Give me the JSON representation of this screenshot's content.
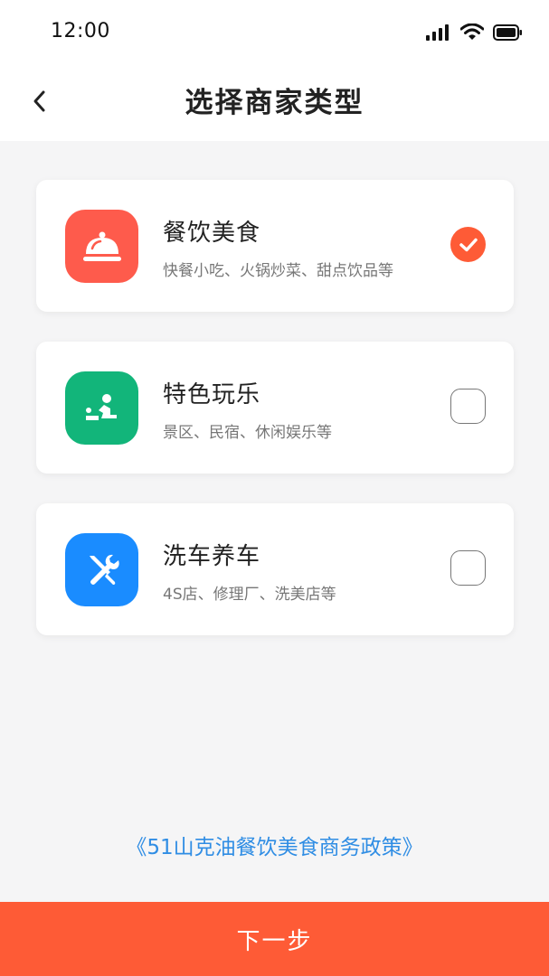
{
  "status_bar": {
    "time": "12:00",
    "icons": [
      "signal-icon",
      "wifi-icon",
      "battery-icon"
    ]
  },
  "header": {
    "back_icon": "chevron-left-icon",
    "title": "选择商家类型"
  },
  "options": [
    {
      "title": "餐饮美食",
      "subtitle": "快餐小吃、火锅炒菜、甜点饮品等",
      "icon": "cloche-icon",
      "icon_color": "#fe5b4c",
      "selected": true
    },
    {
      "title": "特色玩乐",
      "subtitle": "景区、民宿、休闲娱乐等",
      "icon": "recreation-icon",
      "icon_color": "#12b57a",
      "selected": false
    },
    {
      "title": "洗车养车",
      "subtitle": "4S店、修理厂、洗美店等",
      "icon": "wrench-screwdriver-icon",
      "icon_color": "#1a8cff",
      "selected": false
    }
  ],
  "policy_link": "《51山克油餐饮美食商务政策》",
  "next_button": "下一步",
  "colors": {
    "accent": "#fe5b36",
    "link": "#2f8de4",
    "background": "#f5f5f6"
  }
}
